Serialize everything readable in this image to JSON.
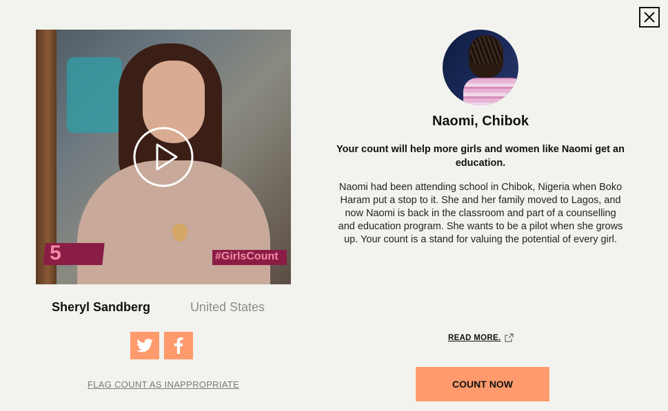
{
  "modal": {
    "close_icon": "close-icon"
  },
  "video": {
    "badge_number": "5",
    "badge_hashtag": "#GirlsCount",
    "play_icon": "play-icon"
  },
  "counter": {
    "name": "Sheryl Sandberg",
    "country": "United States",
    "share": [
      {
        "icon": "twitter-icon",
        "color": "#ff9a6c"
      },
      {
        "icon": "facebook-icon",
        "color": "#ff9a6c"
      }
    ],
    "flag_link": "FLAG COUNT AS INAPPROPRIATE"
  },
  "story": {
    "name": "Naomi, Chibok",
    "lead": "Your count will help more girls and women like Naomi get an education.",
    "body": "Naomi had been attending school in Chibok, Nigeria when Boko Haram put a stop to it. She and her family moved to Lagos, and now Naomi is back in the classroom and part of a counselling and education program. She wants to be a pilot when she grows up. Your count is a stand for valuing the potential of every girl.",
    "read_more": "READ MORE.",
    "external_icon": "external-link-icon"
  },
  "cta": {
    "label": "COUNT NOW",
    "color": "#ff9a6c"
  }
}
